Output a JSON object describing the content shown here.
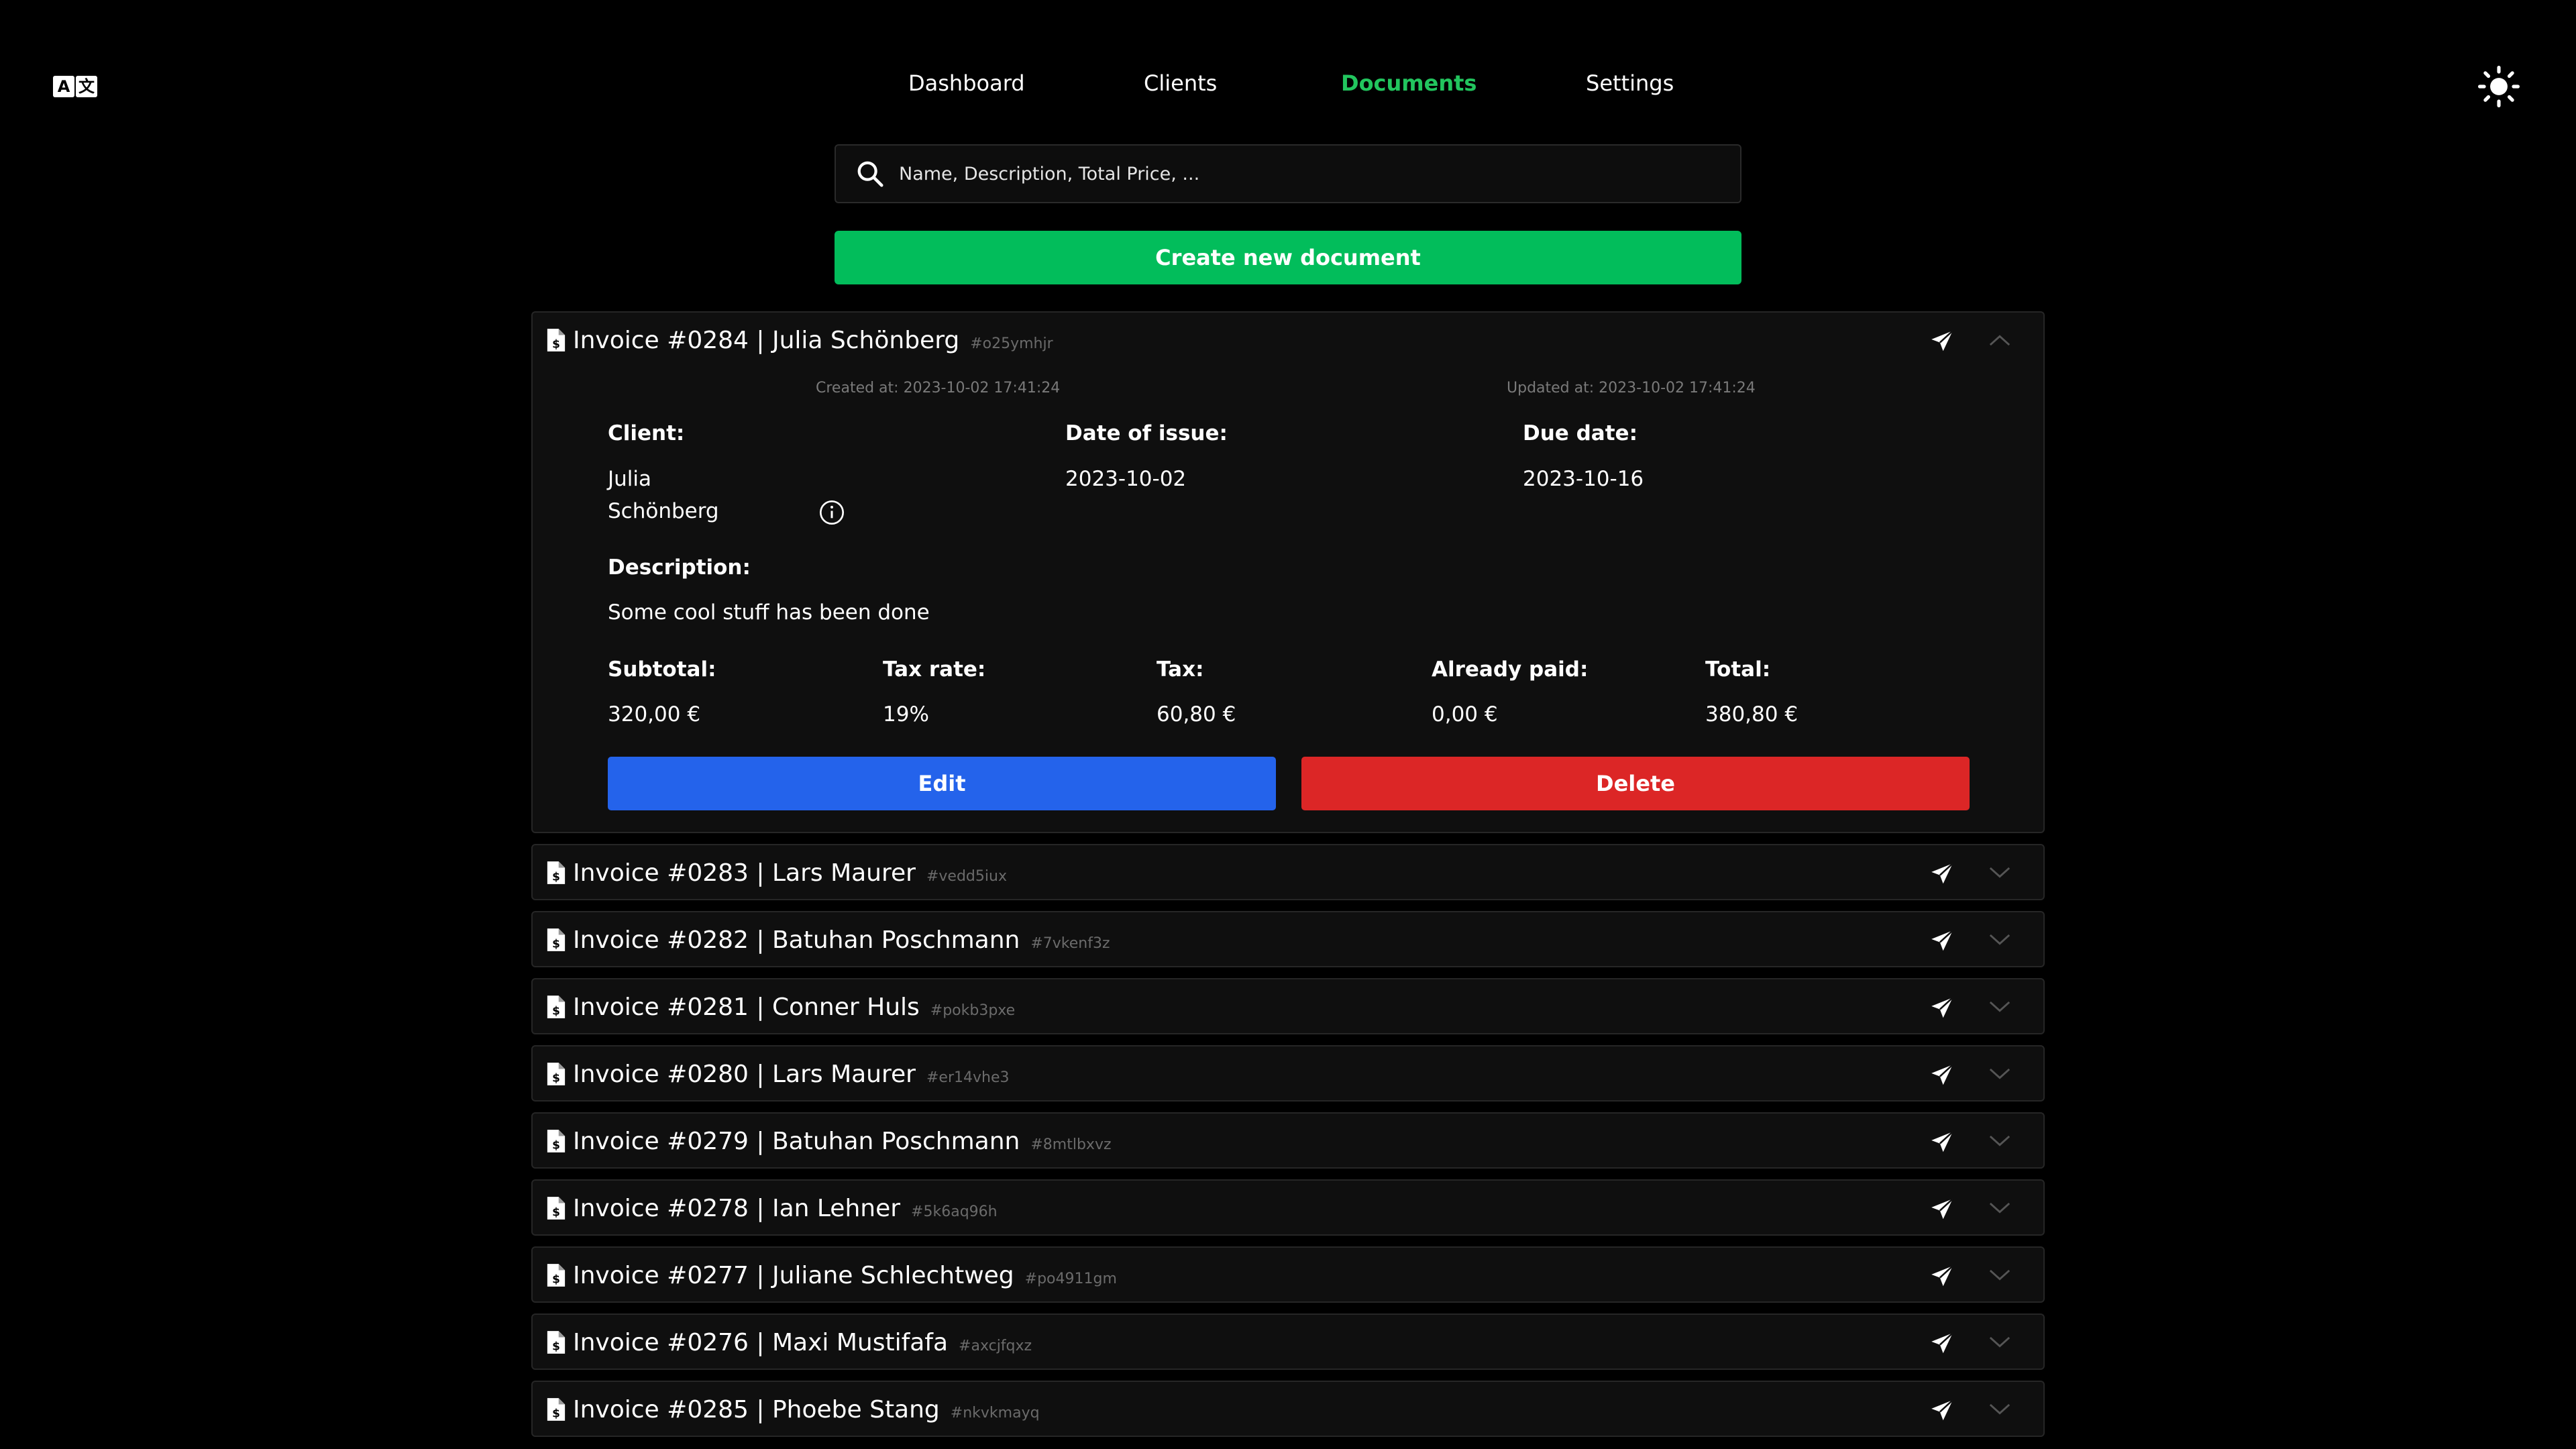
{
  "nav": {
    "items": [
      {
        "label": "Dashboard",
        "active": false
      },
      {
        "label": "Clients",
        "active": false
      },
      {
        "label": "Documents",
        "active": true
      },
      {
        "label": "Settings",
        "active": false
      }
    ]
  },
  "lang_icon": {
    "left": "A",
    "right": "文"
  },
  "search": {
    "placeholder": "Name, Description, Total Price, ..."
  },
  "create_button": "Create new document",
  "expanded": {
    "title": "Invoice #0284 | Julia Schönberg",
    "id": "#o25ymhjr",
    "created": "Created at: 2023-10-02 17:41:24",
    "updated": "Updated at: 2023-10-02 17:41:24",
    "client_label": "Client:",
    "client_first": "Julia",
    "client_last": "Schönberg",
    "issue_label": "Date of issue:",
    "issue_value": "2023-10-02",
    "due_label": "Due date:",
    "due_value": "2023-10-16",
    "description_label": "Description:",
    "description_value": "Some cool stuff has been done",
    "subtotal_label": "Subtotal:",
    "subtotal_value": "320,00 €",
    "taxrate_label": "Tax rate:",
    "taxrate_value": "19%",
    "tax_label": "Tax:",
    "tax_value": "60,80 €",
    "paid_label": "Already paid:",
    "paid_value": "0,00 €",
    "total_label": "Total:",
    "total_value": "380,80 €",
    "edit_label": "Edit",
    "delete_label": "Delete"
  },
  "documents": [
    {
      "title": "Invoice #0283 | Lars Maurer",
      "id": "#vedd5iux"
    },
    {
      "title": "Invoice #0282 | Batuhan Poschmann",
      "id": "#7vkenf3z"
    },
    {
      "title": "Invoice #0281 | Conner Huls",
      "id": "#pokb3pxe"
    },
    {
      "title": "Invoice #0280 | Lars Maurer",
      "id": "#er14vhe3"
    },
    {
      "title": "Invoice #0279 | Batuhan Poschmann",
      "id": "#8mtlbxvz"
    },
    {
      "title": "Invoice #0278 | Ian Lehner",
      "id": "#5k6aq96h"
    },
    {
      "title": "Invoice #0277 | Juliane Schlechtweg",
      "id": "#po4911gm"
    },
    {
      "title": "Invoice #0276 | Maxi Mustifafa",
      "id": "#axcjfqxz"
    },
    {
      "title": "Invoice #0285 | Phoebe Stang",
      "id": "#nkvkmayq"
    }
  ],
  "colors": {
    "accent": "#22c55e",
    "create": "#02bd5b",
    "edit": "#2463eb",
    "delete": "#dc2626"
  }
}
